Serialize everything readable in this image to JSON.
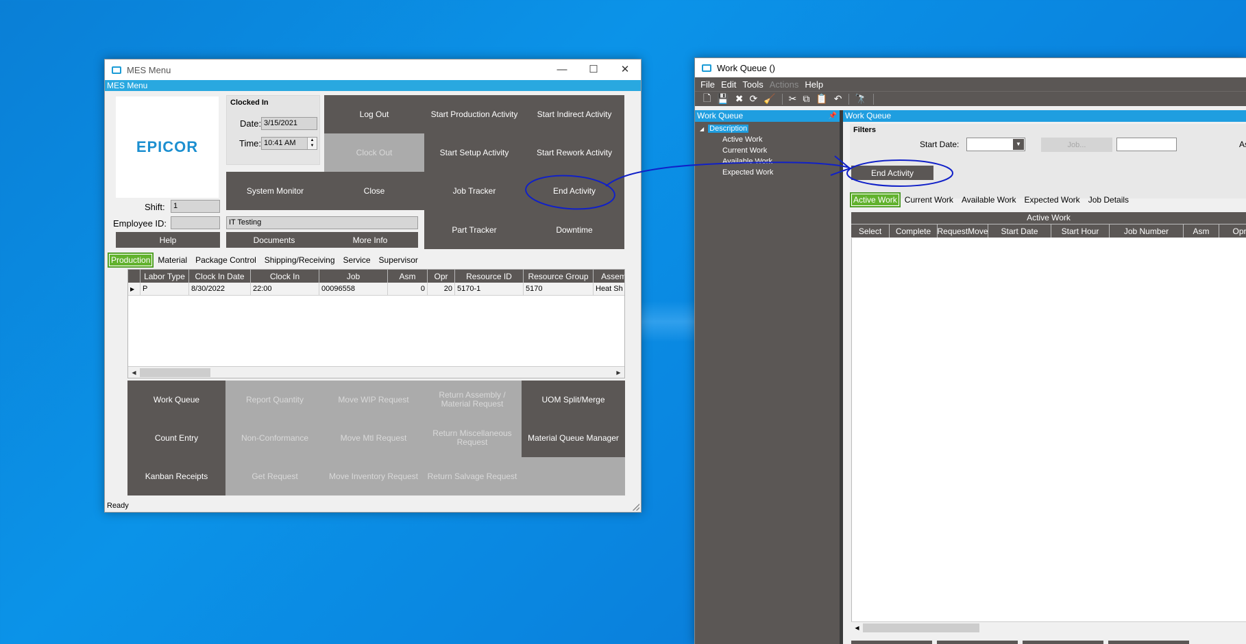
{
  "mes": {
    "window_title": "MES Menu",
    "menu_label": "MES Menu",
    "logo_text": "EPICOR",
    "clocked_in_header": "Clocked In",
    "date_label": "Date:",
    "date_value": "3/15/2021",
    "time_label": "Time:",
    "time_value": "10:41 AM",
    "shift_label": "Shift:",
    "shift_value": "1",
    "employee_label": "Employee ID:",
    "employee_value": "",
    "employee_name": "IT Testing",
    "buttons": {
      "log_out": "Log Out",
      "clock_out": "Clock Out",
      "start_production": "Start Production Activity",
      "start_indirect": "Start Indirect Activity",
      "start_setup": "Start Setup Activity",
      "start_rework": "Start Rework Activity",
      "system_monitor": "System Monitor",
      "close": "Close",
      "job_tracker": "Job Tracker",
      "end_activity": "End Activity",
      "help": "Help",
      "documents": "Documents",
      "more_info": "More Info",
      "part_tracker": "Part Tracker",
      "downtime": "Downtime"
    },
    "tabs": [
      "Production",
      "Material",
      "Package Control",
      "Shipping/Receiving",
      "Service",
      "Supervisor"
    ],
    "grid": {
      "columns": [
        "Labor Type",
        "Clock In Date",
        "Clock In",
        "Job",
        "Asm",
        "Opr",
        "Resource ID",
        "Resource Group",
        "Assem"
      ],
      "rows": [
        [
          "P",
          "8/30/2022",
          "22:00",
          "00096558",
          "0",
          "20",
          "5170-1",
          "5170",
          "Heat Sh"
        ]
      ]
    },
    "actions": {
      "work_queue": "Work Queue",
      "report_quantity": "Report Quantity",
      "move_wip": "Move WIP Request",
      "return_assembly": "Return Assembly / Material Request",
      "uom_split": "UOM Split/Merge",
      "count_entry": "Count Entry",
      "non_conformance": "Non-Conformance",
      "move_mtl": "Move Mtl Request",
      "return_misc": "Return Miscellaneous Request",
      "material_queue": "Material Queue Manager",
      "kanban": "Kanban Receipts",
      "get_request": "Get Request",
      "move_inventory": "Move Inventory Request",
      "return_salvage": "Return Salvage Request"
    },
    "status": "Ready"
  },
  "wq": {
    "window_title": "Work Queue  ()",
    "menu": [
      "File",
      "Edit",
      "Tools",
      "Actions",
      "Help"
    ],
    "left_panel_title": "Work Queue",
    "right_panel_title": "Work Queue",
    "tree_root": "Description",
    "tree_items": [
      "Active Work",
      "Current Work",
      "Available Work",
      "Expected Work"
    ],
    "filters_label": "Filters",
    "start_date_label": "Start Date:",
    "start_date_value": "",
    "job_button": "Job...",
    "job_value": "",
    "asm_label": "Asm:",
    "end_activity": "End Activity",
    "tabs": [
      "Active Work",
      "Current Work",
      "Available Work",
      "Expected Work",
      "Job Details"
    ],
    "grid_title": "Active Work",
    "grid_columns": [
      "Select",
      "Complete",
      "RequestMove",
      "Start Date",
      "Start Hour",
      "Job Number",
      "Asm",
      "Opr"
    ]
  },
  "colors": {
    "accent": "#29a8e0",
    "tab_active": "#62b22e",
    "button_dark": "#5b5755",
    "button_disabled": "#ababab",
    "annotation_ink": "#1020c8"
  }
}
